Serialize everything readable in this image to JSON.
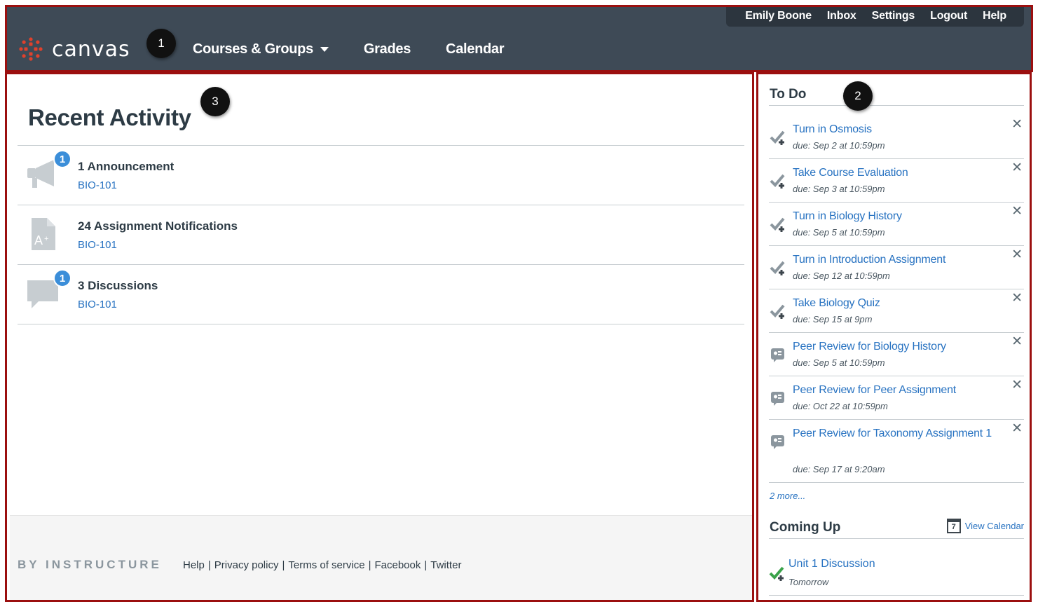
{
  "user_nav": {
    "name": "Emily Boone",
    "inbox": "Inbox",
    "settings": "Settings",
    "logout": "Logout",
    "help": "Help"
  },
  "brand": {
    "wordmark": "canvas",
    "accent": "#e0412c"
  },
  "main_nav": {
    "courses": "Courses & Groups",
    "grades": "Grades",
    "calendar": "Calendar"
  },
  "callouts": {
    "one": "1",
    "two": "2",
    "three": "3"
  },
  "page_title": "Recent Activity",
  "activity": [
    {
      "icon": "megaphone-icon",
      "badge": "1",
      "title": "1 Announcement",
      "course": "BIO-101"
    },
    {
      "icon": "assignment-icon",
      "badge": "",
      "title": "24 Assignment Notifications",
      "course": "BIO-101"
    },
    {
      "icon": "discussion-icon",
      "badge": "1",
      "title": "3 Discussions",
      "course": "BIO-101"
    }
  ],
  "footer": {
    "brand": "BY INSTRUCTURE",
    "links": [
      "Help",
      "Privacy policy",
      "Terms of service",
      "Facebook",
      "Twitter"
    ]
  },
  "todo": {
    "heading": "To Do",
    "items": [
      {
        "icon": "check-plus-icon",
        "title": "Turn in Osmosis",
        "due": "due: Sep 2 at 10:59pm"
      },
      {
        "icon": "check-plus-icon",
        "title": "Take Course Evaluation",
        "due": "due: Sep 3 at 10:59pm"
      },
      {
        "icon": "check-plus-icon",
        "title": "Turn in Biology History",
        "due": "due: Sep 5 at 10:59pm"
      },
      {
        "icon": "check-plus-icon",
        "title": "Turn in Introduction Assignment",
        "due": "due: Sep 12 at 10:59pm"
      },
      {
        "icon": "check-plus-icon",
        "title": "Take Biology Quiz",
        "due": "due: Sep 15 at 9pm"
      },
      {
        "icon": "peer-review-icon",
        "title": "Peer Review for Biology History",
        "due": "due: Sep 5 at 10:59pm"
      },
      {
        "icon": "peer-review-icon",
        "title": "Peer Review for Peer Assignment",
        "due": "due: Oct 22 at 10:59pm"
      },
      {
        "icon": "peer-review-icon",
        "title": "Peer Review for Taxonomy Assignment 1",
        "due": "due: Sep 17 at 9:20am"
      }
    ],
    "close_glyph": "✕",
    "more": "2 more..."
  },
  "coming_up": {
    "heading": "Coming Up",
    "view_calendar": "View Calendar",
    "calendar_day": "7",
    "items": [
      {
        "icon": "check-plus-green-icon",
        "title": "Unit 1 Discussion",
        "when": "Tomorrow"
      }
    ]
  }
}
